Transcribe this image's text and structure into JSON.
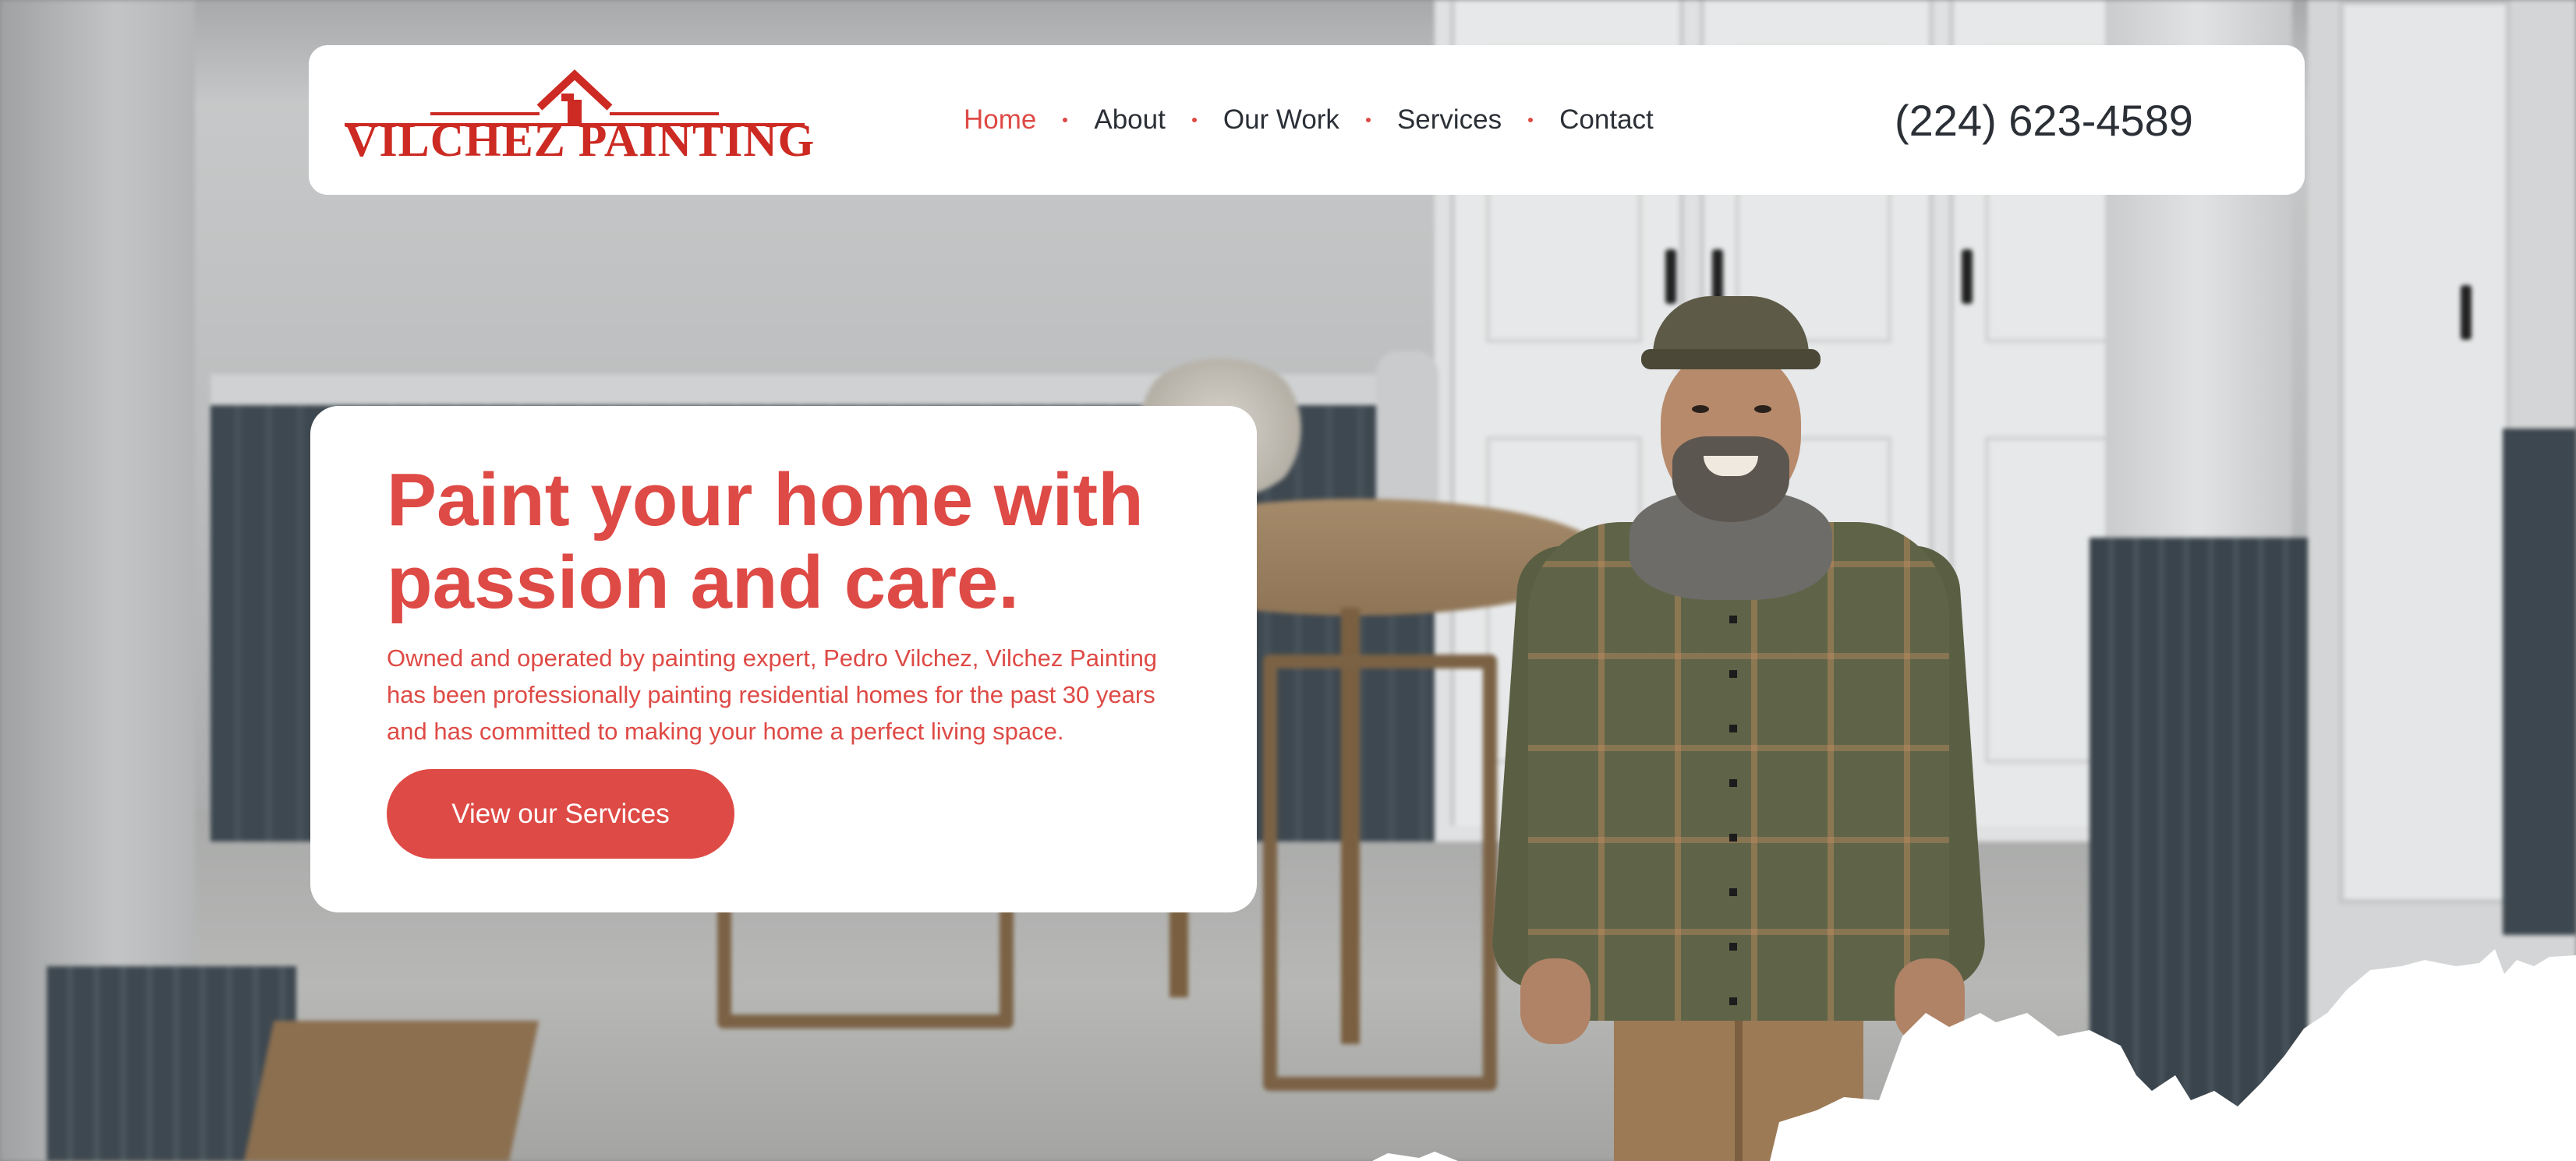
{
  "header": {
    "logo_text": "VILCHEZ PAINTING",
    "nav": [
      {
        "label": "Home",
        "active": true
      },
      {
        "label": "About",
        "active": false
      },
      {
        "label": "Our Work",
        "active": false
      },
      {
        "label": "Services",
        "active": false
      },
      {
        "label": "Contact",
        "active": false
      }
    ],
    "phone": "(224) 623-4589"
  },
  "hero": {
    "title": "Paint your home with passion and care.",
    "description": "Owned and operated by painting expert, Pedro Vilchez, Vilchez Painting has been professionally painting residential homes for the past 30 years and has committed to making your home a perfect living space.",
    "cta_label": "View our Services"
  },
  "colors": {
    "accent": "#de4a45",
    "logo_red": "#cc2a22",
    "text_dark": "#2b2f36",
    "card_bg": "#ffffff"
  },
  "icons": {
    "logo": "house-roof-icon",
    "nav_separator": "dot-icon"
  }
}
